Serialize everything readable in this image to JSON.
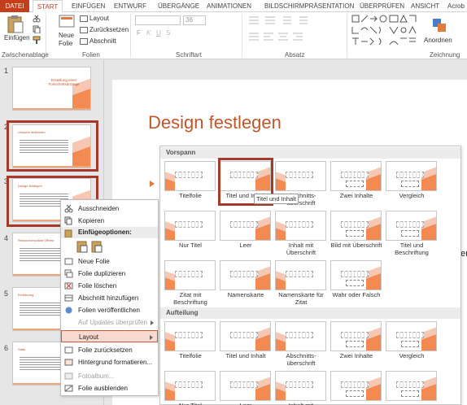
{
  "tabs": [
    "DATEI",
    "START",
    "EINFÜGEN",
    "ENTWURF",
    "ÜBERGÄNGE",
    "ANIMATIONEN",
    "BILDSCHIRMPRÄSENTATION",
    "ÜBERPRÜFEN",
    "ANSICHT",
    "Acrob"
  ],
  "ribbon": {
    "paste_label": "Einfügen",
    "new_slide_label_1": "Neue",
    "new_slide_label_2": "Folie",
    "layout_label": "Layout",
    "reset_label": "Zurücksetzen",
    "section_label": "Abschnitt",
    "font_size": "36",
    "arrange_label": "Anordnen",
    "groups": {
      "clipboard": "Zwischenablage",
      "slides": "Folien",
      "font": "Schriftart",
      "paragraph": "Absatz",
      "drawing": "Zeichnung"
    }
  },
  "slides": [
    {
      "num": "1",
      "title": "Erstellung einer Fortschrittsanzeige"
    },
    {
      "num": "2",
      "title": "Ursache definieren"
    },
    {
      "num": "3",
      "title": "Design festlegen"
    },
    {
      "num": "4",
      "title": "Ressourcenpläne Offnen"
    },
    {
      "num": "5",
      "title": "Einführung"
    },
    {
      "num": "6",
      "title": "Stats"
    }
  ],
  "slide": {
    "title": "Design festlegen",
    "partial_text": "ner I"
  },
  "context_menu": {
    "cut": "Ausschneiden",
    "copy": "Kopieren",
    "paste_options": "Einfügeoptionen:",
    "new_slide": "Neue Folie",
    "duplicate": "Folie duplizieren",
    "delete": "Folie löschen",
    "add_section": "Abschnitt hinzufügen",
    "publish": "Folien veröffentlichen",
    "check_updates": "Auf Updates überprüfen",
    "layout": "Layout",
    "reset": "Folie zurücksetzen",
    "format_bg": "Hintergrund formatieren...",
    "photo_album": "Fotoalbum...",
    "hide": "Folie ausblenden"
  },
  "gallery": {
    "section1": "Vorspann",
    "section2": "Aufteilung",
    "layouts1": [
      "Titelfolie",
      "Titel und Inhalt",
      "Abschnitts-überschrift",
      "Zwei Inhalte",
      "Vergleich",
      "Nur Titel",
      "Leer",
      "Inhalt mit Überschrift",
      "Bild mit Überschrift",
      "Titel und Beschriftung",
      "Zitat mit Beschriftung",
      "Namenskarte",
      "Namenskarte für Zitat",
      "Wahr oder Falsch"
    ],
    "layouts2": [
      "Titelfolie",
      "Titel und Inhalt",
      "Abschnitts-überschrift",
      "Zwei Inhalte",
      "Vergleich",
      "Nur Titel",
      "Leer",
      "Inhalt mit",
      "",
      ""
    ],
    "tooltip": "Titel und Inhalt"
  },
  "colors": {
    "accent": "#c43e1c",
    "title": "#c0562b",
    "selection": "#a33a2b"
  }
}
